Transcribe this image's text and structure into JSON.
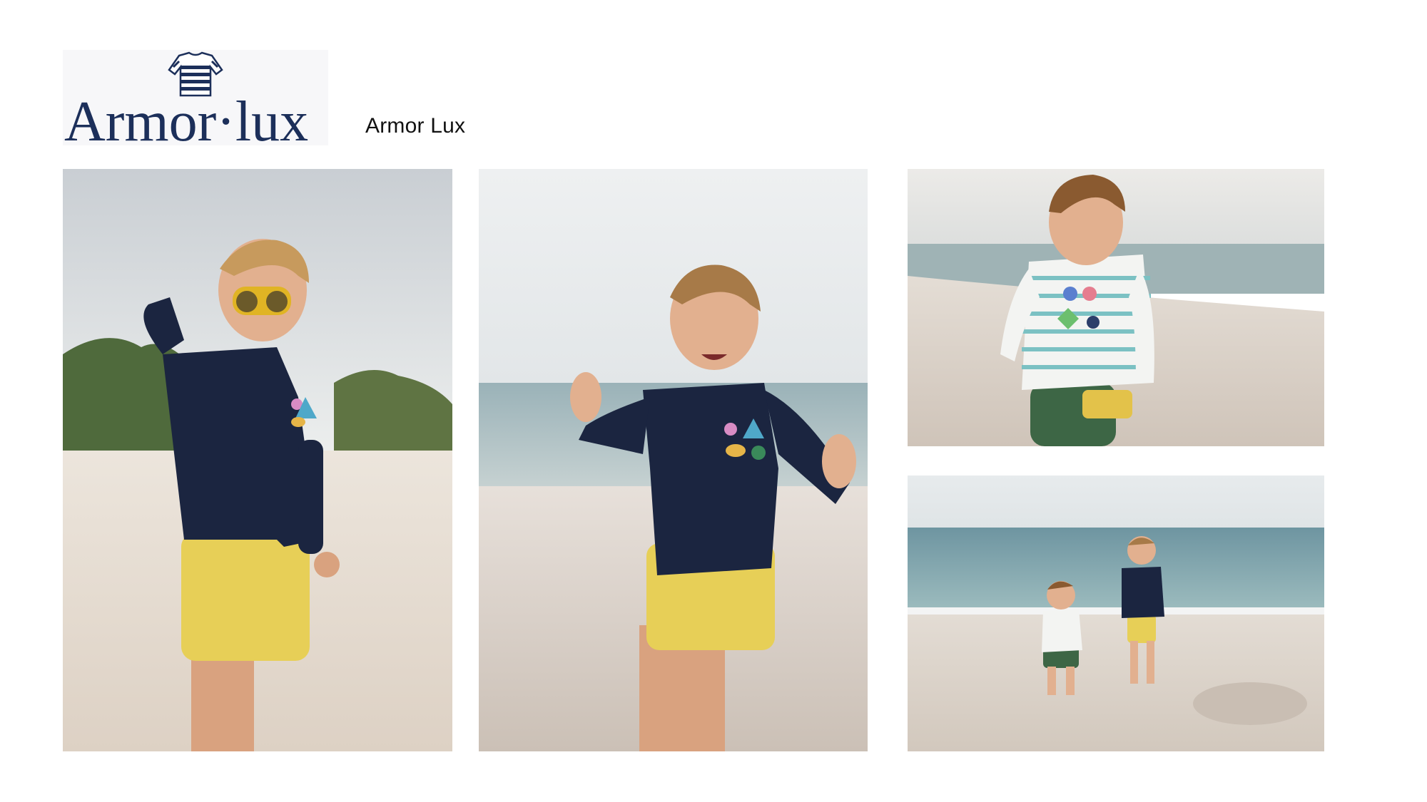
{
  "brand": {
    "logo_text": "Armor·lux",
    "name": "Armor Lux",
    "logo_color": "#1c2f5a",
    "logo_icon": "striped-shirt-icon"
  },
  "gallery": {
    "photos": [
      {
        "subject": "boy-binoculars-beach"
      },
      {
        "subject": "boy-waving-beach"
      },
      {
        "subject": "toddler-striped-shirt-beach"
      },
      {
        "subject": "two-boys-playing-beach"
      }
    ]
  },
  "colors": {
    "navy": "#1b2540",
    "yellow": "#e7cf57",
    "sand": "#e6ddd3",
    "sky": "#dfe3e6",
    "sea": "#8aa6ad"
  }
}
